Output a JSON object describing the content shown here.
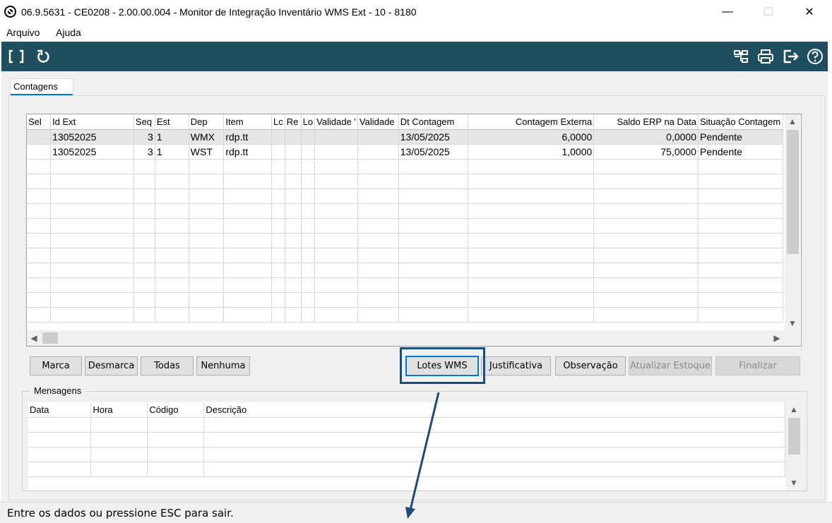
{
  "window": {
    "title": "06.9.5631 - CE0208 - 2.00.00.004 - Monitor de Integração Inventário WMS Ext - 10 - 8180",
    "minimize_glyph": "—",
    "maximize_glyph": "☐",
    "close_glyph": "✕"
  },
  "menu": {
    "items": [
      "Arquivo",
      "Ajuda"
    ]
  },
  "toolbar": {
    "left_icons": [
      "brackets-icon",
      "refresh-icon"
    ],
    "right_icons": [
      "tree-icon",
      "print-icon",
      "exit-icon",
      "help-icon"
    ],
    "background": "#1f4e5f"
  },
  "tabs": [
    {
      "label": "Contagens",
      "active": true
    }
  ],
  "grid": {
    "headers": [
      "Sel",
      "Id Ext",
      "Seq",
      "Est",
      "Dep",
      "Item",
      "Lc",
      "Re",
      "Lo",
      "Validade '",
      "Validade",
      "Dt Contagem",
      "Contagem Externa",
      "Saldo ERP na Data",
      "Situação Contagem"
    ],
    "rows": [
      [
        "",
        "13052025",
        "3",
        "1",
        "WMX",
        "rdp.tt",
        "",
        "",
        "",
        "",
        "",
        "13/05/2025",
        "6,0000",
        "0,0000",
        "Pendente"
      ],
      [
        "",
        "13052025",
        "3",
        "1",
        "WST",
        "rdp.tt",
        "",
        "",
        "",
        "",
        "",
        "13/05/2025",
        "1,0000",
        "75,0000",
        "Pendente"
      ]
    ],
    "empty_rows": 11
  },
  "buttons": {
    "marca": "Marca",
    "desmarca": "Desmarca",
    "todas": "Todas",
    "nenhuma": "Nenhuma",
    "lotes_wms": "Lotes WMS",
    "justificativa": "Justificativa",
    "observacao": "Observação",
    "atualizar_estoque": "Atualizar Estoque",
    "finalizar": "Finalizar"
  },
  "messages": {
    "legend": "Mensagens",
    "headers": [
      "Data",
      "Hora",
      "Código",
      "Descrição"
    ],
    "empty_rows": 4
  },
  "status": {
    "text": "Entre os dados ou pressione ESC para sair."
  },
  "colors": {
    "highlight": "#1c4b7c",
    "accent": "#0078d7"
  }
}
